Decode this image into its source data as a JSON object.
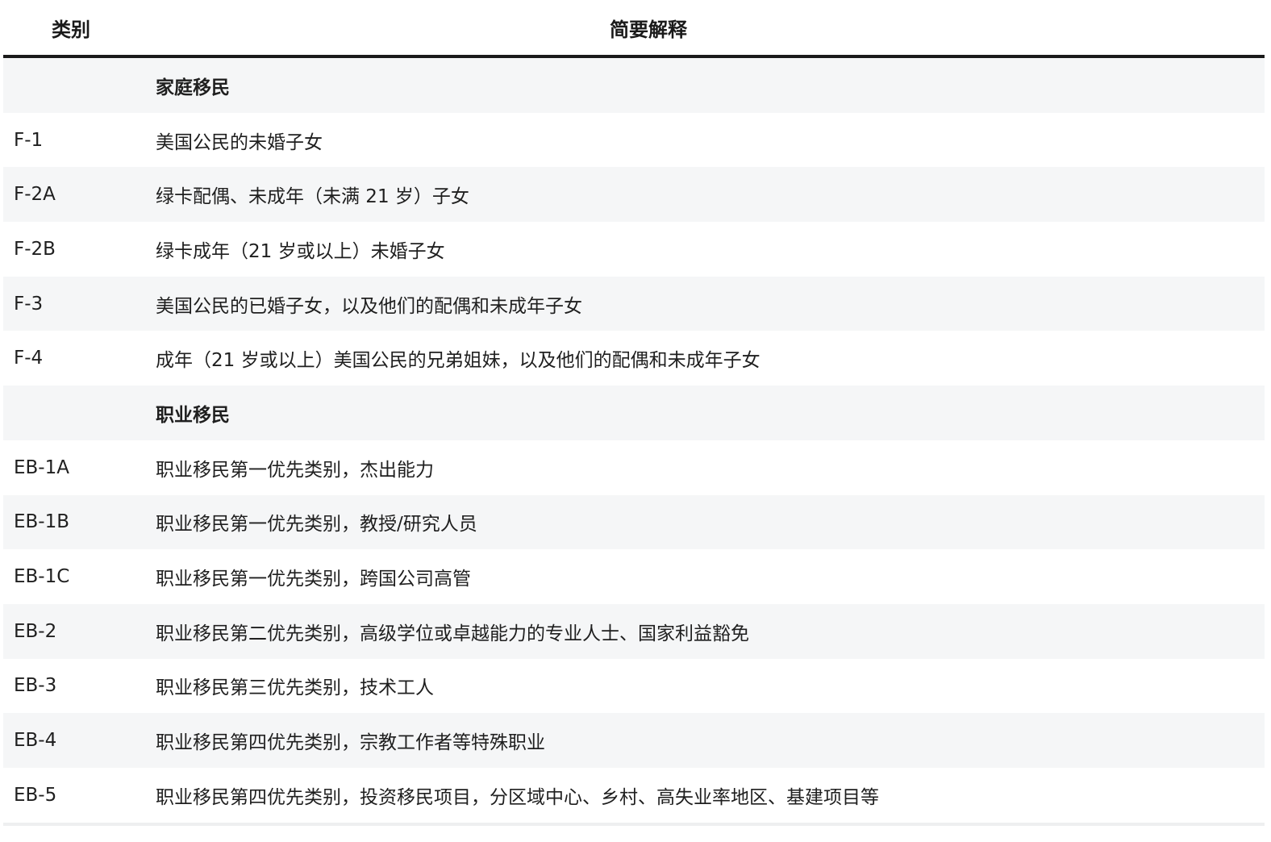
{
  "table": {
    "headers": [
      "类别",
      "简要解释"
    ],
    "rows": [
      {
        "code": "",
        "desc": "家庭移民",
        "section": true
      },
      {
        "code": "F-1",
        "desc": "美国公民的未婚子女"
      },
      {
        "code": "F-2A",
        "desc": "绿卡配偶、未成年（未满 21 岁）子女"
      },
      {
        "code": "F-2B",
        "desc": "绿卡成年（21 岁或以上）未婚子女"
      },
      {
        "code": "F-3",
        "desc": "美国公民的已婚子女，以及他们的配偶和未成年子女"
      },
      {
        "code": "F-4",
        "desc": "成年（21 岁或以上）美国公民的兄弟姐妹，以及他们的配偶和未成年子女"
      },
      {
        "code": "",
        "desc": "职业移民",
        "section": true
      },
      {
        "code": "EB-1A",
        "desc": "职业移民第一优先类别，杰出能力"
      },
      {
        "code": "EB-1B",
        "desc": "职业移民第一优先类别，教授/研究人员"
      },
      {
        "code": "EB-1C",
        "desc": "职业移民第一优先类别，跨国公司高管"
      },
      {
        "code": "EB-2",
        "desc": "职业移民第二优先类别，高级学位或卓越能力的专业人士、国家利益豁免"
      },
      {
        "code": "EB-3",
        "desc": "职业移民第三优先类别，技术工人"
      },
      {
        "code": "EB-4",
        "desc": "职业移民第四优先类别，宗教工作者等特殊职业"
      },
      {
        "code": "EB-5",
        "desc": "职业移民第四优先类别，投资移民项目，分区域中心、乡村、高失业率地区、基建项目等"
      }
    ]
  }
}
